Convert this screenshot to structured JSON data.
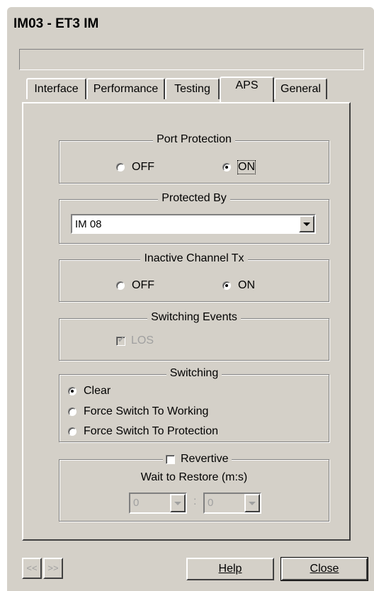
{
  "window": {
    "title": "IM03 - ET3 IM"
  },
  "tabs": [
    {
      "label": "Interface"
    },
    {
      "label": "Performance"
    },
    {
      "label": "Testing"
    },
    {
      "label": "APS"
    },
    {
      "label": "General"
    }
  ],
  "port_protection": {
    "legend": "Port Protection",
    "off_label": "OFF",
    "on_label": "ON",
    "selected": "ON"
  },
  "protected_by": {
    "legend": "Protected By",
    "value": "IM 08"
  },
  "inactive_channel_tx": {
    "legend": "Inactive Channel Tx",
    "off_label": "OFF",
    "on_label": "ON",
    "selected": "ON"
  },
  "switching_events": {
    "legend": "Switching Events",
    "los_label": "LOS",
    "los_checked": true
  },
  "switching": {
    "legend": "Switching",
    "options": [
      {
        "label": "Clear",
        "checked": true
      },
      {
        "label": "Force Switch To Working",
        "checked": false
      },
      {
        "label": "Force Switch To Protection",
        "checked": false
      }
    ]
  },
  "revertive": {
    "label": "Revertive",
    "wait_label": "Wait to Restore (m:s)",
    "minutes": "0",
    "separator": ":",
    "seconds": "0"
  },
  "footer": {
    "prev_label": "<<",
    "next_label": ">>",
    "help_label": "Help",
    "close_label": "Close"
  }
}
